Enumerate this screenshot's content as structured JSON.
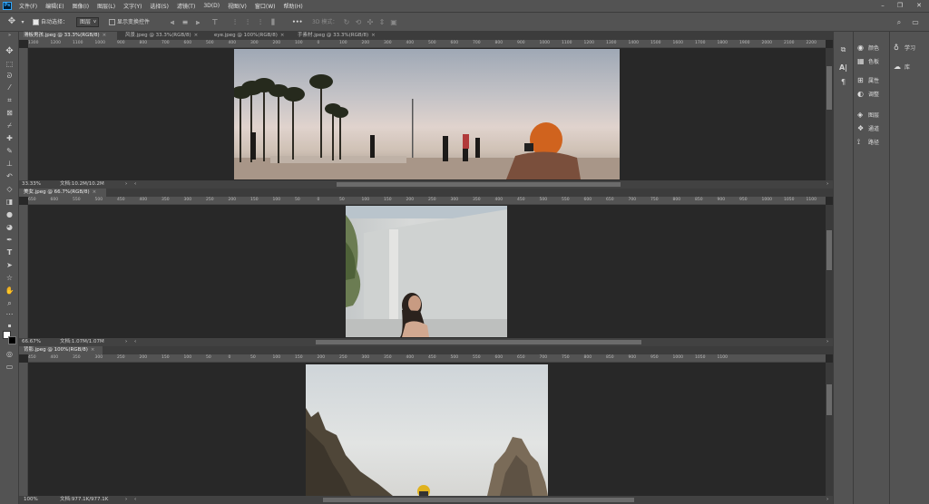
{
  "menubar": {
    "logo": "Ps",
    "items": [
      "文件(F)",
      "编辑(E)",
      "图像(I)",
      "图层(L)",
      "文字(Y)",
      "选择(S)",
      "滤镜(T)",
      "3D(D)",
      "视图(V)",
      "窗口(W)",
      "帮助(H)"
    ]
  },
  "options": {
    "auto_select_label": "自动选择：",
    "auto_select_value": "图层",
    "show_transform_label": "显示变换控件",
    "mode_3d_label": "3D 模式：",
    "more": "•••"
  },
  "documents": [
    {
      "tabs": [
        {
          "label": "滑板男孩.jpeg @ 33.3%(RGB/8)",
          "active": true
        },
        {
          "label": "风景.jpeg @ 33.3%(RGB/8)",
          "active": false
        },
        {
          "label": "eye.jpeg @ 100%(RGB/8)",
          "active": false
        },
        {
          "label": "手素材.jpeg @ 33.3%(RGB/8)",
          "active": false
        }
      ],
      "ruler": [
        "1300",
        "1200",
        "1100",
        "1000",
        "900",
        "800",
        "700",
        "600",
        "500",
        "400",
        "300",
        "200",
        "100",
        "0",
        "100",
        "200",
        "300",
        "400",
        "500",
        "600",
        "700",
        "800",
        "900",
        "1000",
        "1100",
        "1200",
        "1300",
        "1400",
        "1500",
        "1600",
        "1700",
        "1800",
        "1900",
        "2000",
        "2100",
        "2200",
        "2300",
        "2400",
        "2500",
        "2600",
        "2700",
        "2800",
        "2900",
        "3000",
        "3100",
        "3200",
        "3300",
        "3400",
        "3500",
        "3600",
        "3700",
        "3800",
        "3900",
        "4000",
        "4100",
        "4200"
      ],
      "zoom": "33.33%",
      "doc_size": "文档:10.2M/10.2M"
    },
    {
      "tabs": [
        {
          "label": "美女.jpeg @ 66.7%(RGB/8)",
          "active": true
        }
      ],
      "ruler": [
        "650",
        "600",
        "550",
        "500",
        "450",
        "400",
        "350",
        "300",
        "250",
        "200",
        "150",
        "100",
        "50",
        "0",
        "50",
        "100",
        "150",
        "200",
        "250",
        "300",
        "350",
        "400",
        "450",
        "500",
        "550",
        "600",
        "650",
        "700",
        "750",
        "800",
        "850",
        "900",
        "950",
        "1000",
        "1050",
        "1100",
        "1150",
        "1200",
        "1250",
        "1300",
        "1350",
        "1400",
        "1450",
        "1500"
      ],
      "zoom": "66.67%",
      "doc_size": "文档:1.07M/1.07M"
    },
    {
      "tabs": [
        {
          "label": "背影.jpeg @ 100%(RGB/8)",
          "active": true
        }
      ],
      "ruler": [
        "450",
        "400",
        "350",
        "300",
        "250",
        "200",
        "150",
        "100",
        "50",
        "0",
        "50",
        "100",
        "150",
        "200",
        "250",
        "300",
        "350",
        "400",
        "450",
        "500",
        "550",
        "600",
        "650",
        "700",
        "750",
        "800",
        "850",
        "900",
        "950",
        "1000",
        "1050",
        "1100"
      ],
      "zoom": "100%",
      "doc_size": "文档:977.1K/977.1K"
    }
  ],
  "right_panel": {
    "group1": [
      "颜色",
      "色板"
    ],
    "group2": [
      "属性",
      "调整"
    ],
    "group3": [
      "图层",
      "通道",
      "路径"
    ],
    "learn": [
      "学习",
      "库"
    ]
  },
  "colors": {
    "ui_bg": "#535353",
    "canvas_bg": "#282828",
    "accent": "#31a8ff"
  }
}
